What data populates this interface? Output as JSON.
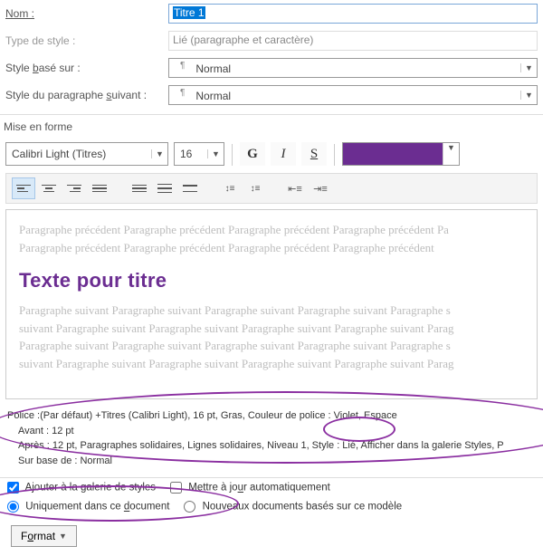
{
  "form": {
    "name_label": "Nom :",
    "name_value": "Titre 1",
    "styletype_label": "Type de style :",
    "styletype_value": "Lié (paragraphe et caractère)",
    "based_label": "Style basé sur :",
    "based_value": "Normal",
    "following_label": "Style du paragraphe suivant :",
    "following_value": "Normal"
  },
  "section_formatting": "Mise en forme",
  "toolbar": {
    "font_name": "Calibri Light (Titres)",
    "font_size": "16",
    "bold_glyph": "G",
    "italic_glyph": "I",
    "underline_glyph": "S",
    "color_hex": "#6b2d91"
  },
  "preview": {
    "prev_para": "Paragraphe précédent Paragraphe précédent Paragraphe précédent Paragraphe précédent Pa",
    "prev_para2": "Paragraphe précédent Paragraphe précédent Paragraphe précédent Paragraphe précédent",
    "sample_title": "Texte pour titre",
    "next_para1": "Paragraphe suivant Paragraphe suivant Paragraphe suivant Paragraphe suivant Paragraphe s",
    "next_para2": "suivant Paragraphe suivant Paragraphe suivant Paragraphe suivant Paragraphe suivant Parag",
    "next_para3": "Paragraphe suivant Paragraphe suivant Paragraphe suivant Paragraphe suivant Paragraphe s",
    "next_para4": "suivant Paragraphe suivant Paragraphe suivant Paragraphe suivant Paragraphe suivant Parag"
  },
  "summary": {
    "line1": "Police :(Par défaut) +Titres (Calibri Light), 16 pt, Gras, Couleur de police : Violet, Espace",
    "line2": "Avant : 12 pt",
    "line3": "Après : 12 pt, Paragraphes solidaires, Lignes solidaires, Niveau 1, Style : Lié, Afficher dans la galerie Styles, P",
    "line4": "Sur base de : Normal"
  },
  "options": {
    "add_gallery": "A",
    "add_gallery_u": "j",
    "add_gallery_rest": "outer à la galerie de styles",
    "auto_update": "Mettre à jo",
    "auto_update_u": "u",
    "auto_update_rest": "r automatiquement",
    "only_doc": "Uniquement dans ce ",
    "only_doc_u": "d",
    "only_doc_rest": "ocument",
    "new_docs": "Nouveaux documents basés sur ce modèle"
  },
  "buttons": {
    "format": "Format"
  }
}
